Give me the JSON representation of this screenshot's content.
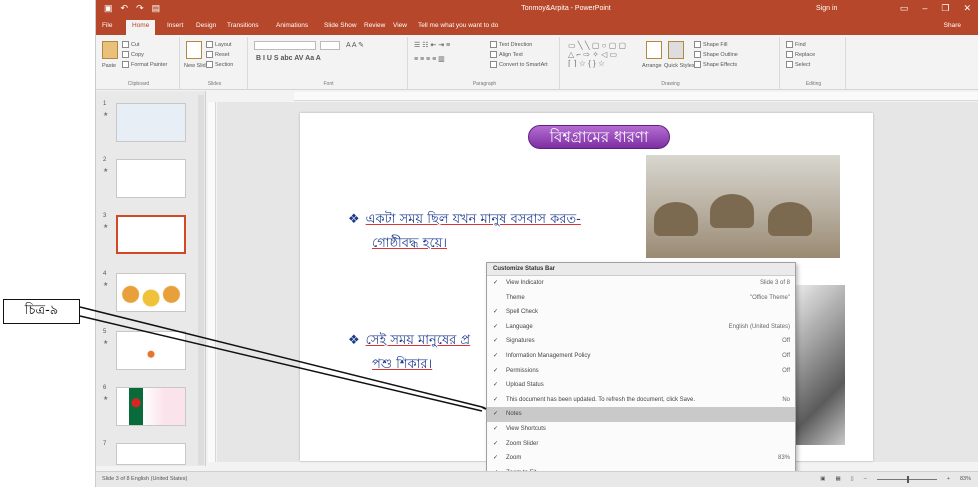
{
  "window": {
    "title": "Tonmoy&Arpita - PowerPoint",
    "sign_in": "Sign in",
    "share": "Share"
  },
  "tabs": [
    "File",
    "Home",
    "Insert",
    "Design",
    "Transitions",
    "Animations",
    "Slide Show",
    "Review",
    "View",
    "Tell me what you want to do"
  ],
  "ribbon": {
    "clipboard": {
      "label": "Clipboard",
      "paste": "Paste",
      "cut": "Cut",
      "copy": "Copy",
      "format_painter": "Format Painter"
    },
    "slides": {
      "label": "Slides",
      "new_slide": "New Slide",
      "layout": "Layout",
      "reset": "Reset",
      "section": "Section"
    },
    "font": {
      "label": "Font"
    },
    "paragraph": {
      "label": "Paragraph",
      "text_direction": "Text Direction",
      "align_text": "Align Text",
      "convert": "Convert to SmartArt"
    },
    "drawing": {
      "label": "Drawing",
      "arrange": "Arrange",
      "quick_styles": "Quick Styles",
      "shape_fill": "Shape Fill",
      "shape_outline": "Shape Outline",
      "shape_effects": "Shape Effects"
    },
    "editing": {
      "label": "Editing",
      "find": "Find",
      "replace": "Replace",
      "select": "Select"
    }
  },
  "thumbnails": [
    {
      "number": "1"
    },
    {
      "number": "2"
    },
    {
      "number": "3"
    },
    {
      "number": "4"
    },
    {
      "number": "5"
    },
    {
      "number": "6"
    },
    {
      "number": "7"
    }
  ],
  "slide": {
    "title": "বিশ্বগ্রামের ধারণা",
    "bullet1_line1": "একটা সময় ছিল যখন মানুষ বসবাস করত-",
    "bullet1_line2": "গোষ্ঠীবদ্ধ হয়ে।",
    "bullet2_line1": "সেই সময় মানুষের প্র",
    "bullet2_line2": "পশু শিকার।"
  },
  "context_menu": {
    "title": "Customize Status Bar",
    "items": [
      {
        "label": "View Indicator",
        "value": "Slide 3 of 8",
        "checked": true
      },
      {
        "label": "Theme",
        "value": "\"Office Theme\"",
        "checked": false
      },
      {
        "label": "Spell Check",
        "value": "",
        "checked": true
      },
      {
        "label": "Language",
        "value": "English (United States)",
        "checked": true
      },
      {
        "label": "Signatures",
        "value": "Off",
        "checked": true
      },
      {
        "label": "Information Management Policy",
        "value": "Off",
        "checked": true
      },
      {
        "label": "Permissions",
        "value": "Off",
        "checked": true
      },
      {
        "label": "Upload Status",
        "value": "",
        "checked": true
      },
      {
        "label": "This document has been updated. To refresh the document, click Save.",
        "value": "No",
        "checked": true
      },
      {
        "label": "Notes",
        "value": "",
        "checked": true,
        "highlighted": true
      },
      {
        "label": "View Shortcuts",
        "value": "",
        "checked": true
      },
      {
        "label": "Zoom Slider",
        "value": "",
        "checked": true
      },
      {
        "label": "Zoom",
        "value": "83%",
        "checked": true
      },
      {
        "label": "Zoom to Fit",
        "value": "",
        "checked": true
      }
    ]
  },
  "statusbar": {
    "left": "Slide 3 of 8   English (United States)",
    "zoom": "83%"
  },
  "callout": {
    "label": "চিত্র-৯"
  }
}
